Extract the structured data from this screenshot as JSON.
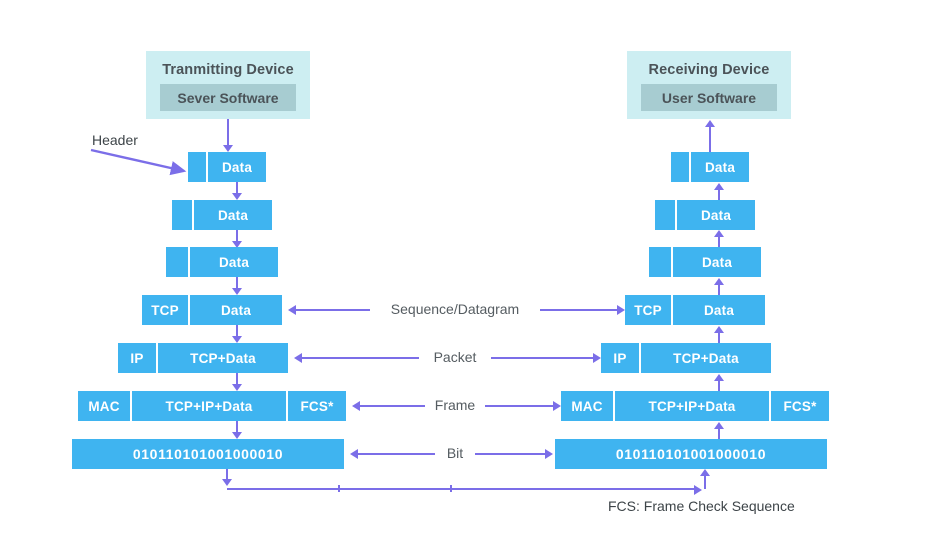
{
  "diagram": {
    "title_typo_note": "",
    "transmitter": {
      "device_label": "Tranmitting Device",
      "software_label": "Sever Software"
    },
    "receiver": {
      "device_label": "Receiving Device",
      "software_label": "User Software"
    },
    "header_callout": "Header",
    "footnote": "FCS: Frame Check Sequence",
    "layers": [
      {
        "header": "",
        "payload": "Data",
        "trailer": "",
        "center_label": ""
      },
      {
        "header": "",
        "payload": "Data",
        "trailer": "",
        "center_label": ""
      },
      {
        "header": "",
        "payload": "Data",
        "trailer": "",
        "center_label": ""
      },
      {
        "header": "TCP",
        "payload": "Data",
        "trailer": "",
        "center_label": "Sequence/Datagram"
      },
      {
        "header": "IP",
        "payload": "TCP+Data",
        "trailer": "",
        "center_label": "Packet"
      },
      {
        "header": "MAC",
        "payload": "TCP+IP+Data",
        "trailer": "FCS*",
        "center_label": "Frame"
      },
      {
        "header": "",
        "payload": "010110101001000010",
        "trailer": "",
        "center_label": "Bit"
      }
    ],
    "colors": {
      "block_blue": "#3fb4f0",
      "device_box": "#cdeef2",
      "software_box": "#a7ccd1",
      "arrow_purple": "#7b6ee8",
      "text_dark": "#4b5358",
      "background": "#ffffff"
    }
  }
}
